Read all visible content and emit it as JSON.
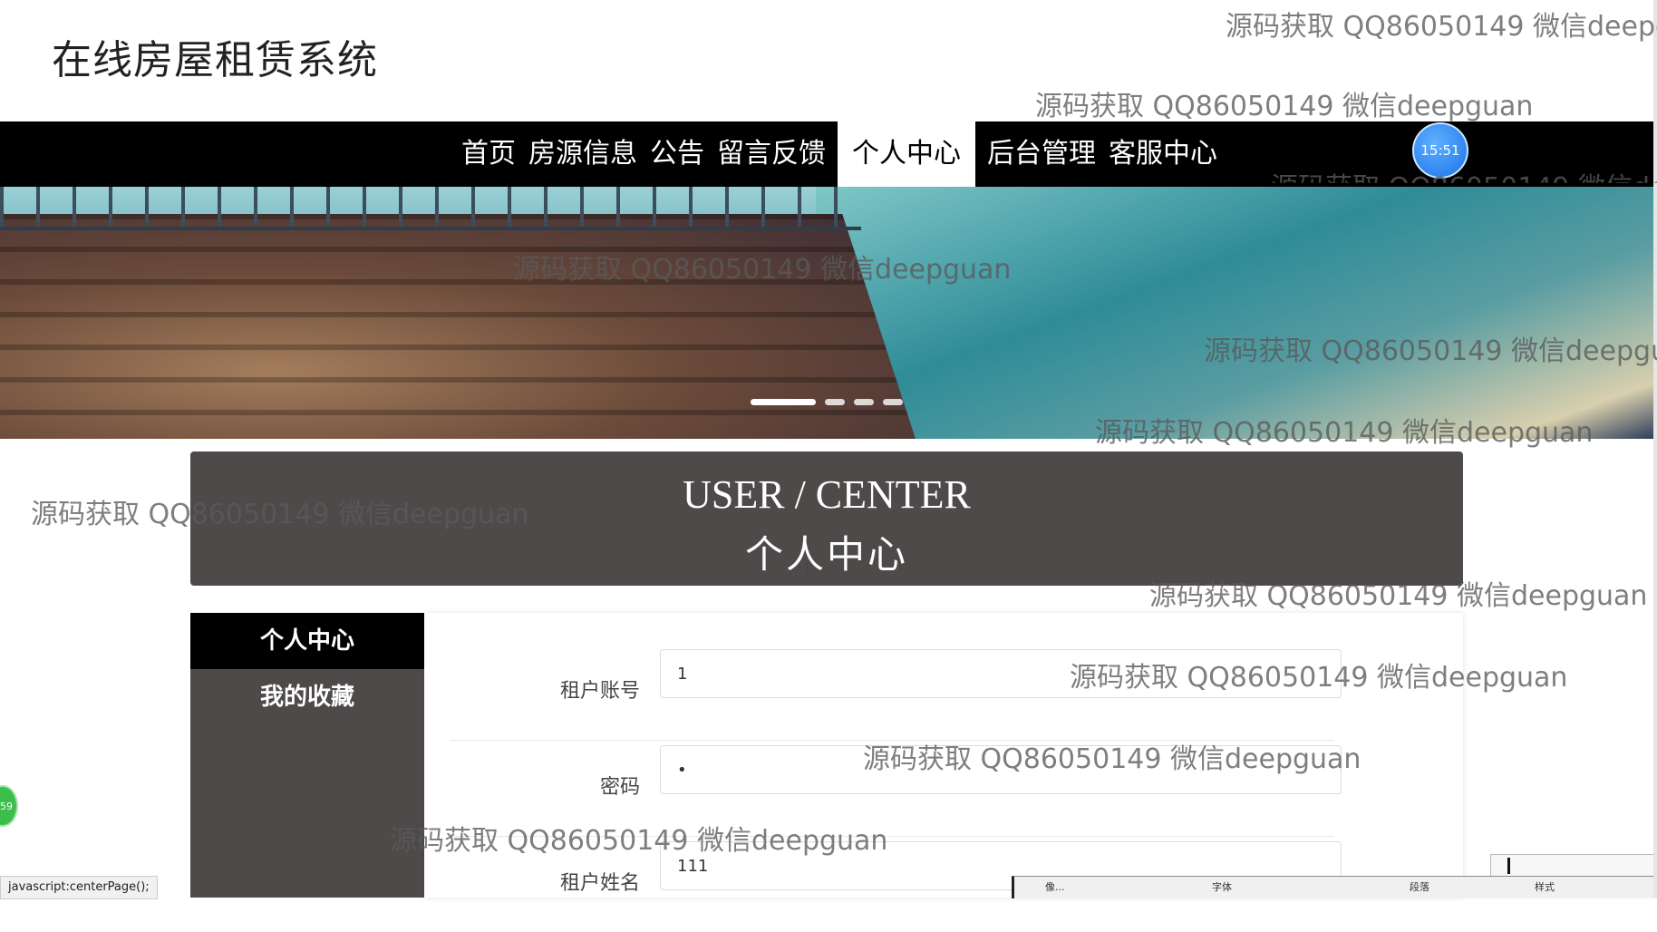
{
  "site": {
    "title": "在线房屋租赁系统"
  },
  "nav": {
    "items": [
      {
        "label": "首页"
      },
      {
        "label": "房源信息"
      },
      {
        "label": "公告"
      },
      {
        "label": "留言反馈"
      },
      {
        "label": "个人中心",
        "active": true
      },
      {
        "label": "后台管理"
      },
      {
        "label": "客服中心"
      }
    ]
  },
  "clock": {
    "time": "15:51"
  },
  "carousel": {
    "slide_count": 4,
    "active_index": 0
  },
  "user_center": {
    "title_en": "USER / CENTER",
    "title_cn": "个人中心"
  },
  "side_menu": {
    "items": [
      {
        "label": "个人中心",
        "active": true
      },
      {
        "label": "我的收藏"
      }
    ]
  },
  "form": {
    "fields": [
      {
        "label": "租户账号",
        "value": "1"
      },
      {
        "label": "密码",
        "value": "•"
      },
      {
        "label": "租户姓名",
        "value": "111"
      }
    ]
  },
  "status_bar": {
    "text": "javascript:centerPage();"
  },
  "green_bubble": {
    "text": "59"
  },
  "ribbon": {
    "labels": [
      "像...",
      "字体",
      "段落",
      "样式"
    ]
  },
  "watermark": {
    "text": "源码获取 QQ86050149 微信deepguan",
    "partial_1": "源码获取 QQ86050149 微信deepg",
    "partial_2": "源码获取 QQ86050149 微信deepgu",
    "partial_3": "源码获取 QQ86050149 微信de"
  },
  "colors": {
    "nav_bg": "#000000",
    "panel_bg": "#4e4a4a",
    "active_nav_bg": "#ffffff"
  },
  "icons": {
    "clock": "clock-bubble-icon",
    "cursor": "text-cursor-icon"
  }
}
